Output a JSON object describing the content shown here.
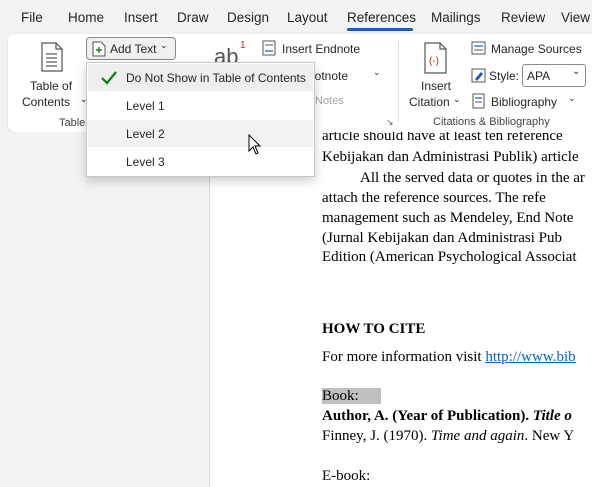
{
  "tabs": [
    "File",
    "Home",
    "Insert",
    "Draw",
    "Design",
    "Layout",
    "References",
    "Mailings",
    "Review",
    "View"
  ],
  "active_tab": "References",
  "ribbon": {
    "toc_line1": "Table of",
    "toc_line2": "Contents",
    "add_text": "Add Text",
    "table_group_label": "Table",
    "insert_endnote": "Insert Endnote",
    "footnote": "ootnote",
    "notes": "Notes",
    "insert_citation_line1": "Insert",
    "insert_citation_line2": "Citation",
    "manage_sources": "Manage Sources",
    "style_label": "Style:",
    "style_value": "APA",
    "bibliography": "Bibliography",
    "citations_group_label": "Citations & Bibliography",
    "ab_text": "ab",
    "ab_sup": "1"
  },
  "dropdown": {
    "items": [
      "Do Not Show in Table of Contents",
      "Level 1",
      "Level 2",
      "Level 3"
    ]
  },
  "document": {
    "line1": "article should have at least ten reference",
    "line2": "Kebijakan dan Administrasi Publik) article",
    "line3": "All the served data or quotes in the ar",
    "line4": "attach the reference sources. The refe",
    "line5": "management such as Mendeley, End Note",
    "line6": "(Jurnal Kebijakan dan Administrasi Pub",
    "line7": "Edition (American Psychological Associat",
    "how_to_cite": "HOW TO CITE",
    "more_info": "For more information visit ",
    "link": "http://www.bib",
    "book_label": "Book:",
    "author_line_bold": "Author, A. (Year of Publication). ",
    "author_line_italic": "Title o",
    "finney_a": "Finney, J. (1970). ",
    "finney_italic": "Time and again",
    "finney_b": ". New Y",
    "ebook_label": "E-book:"
  },
  "colors": {
    "accent": "#185abd",
    "check": "#107c10",
    "link": "#0563c1"
  }
}
